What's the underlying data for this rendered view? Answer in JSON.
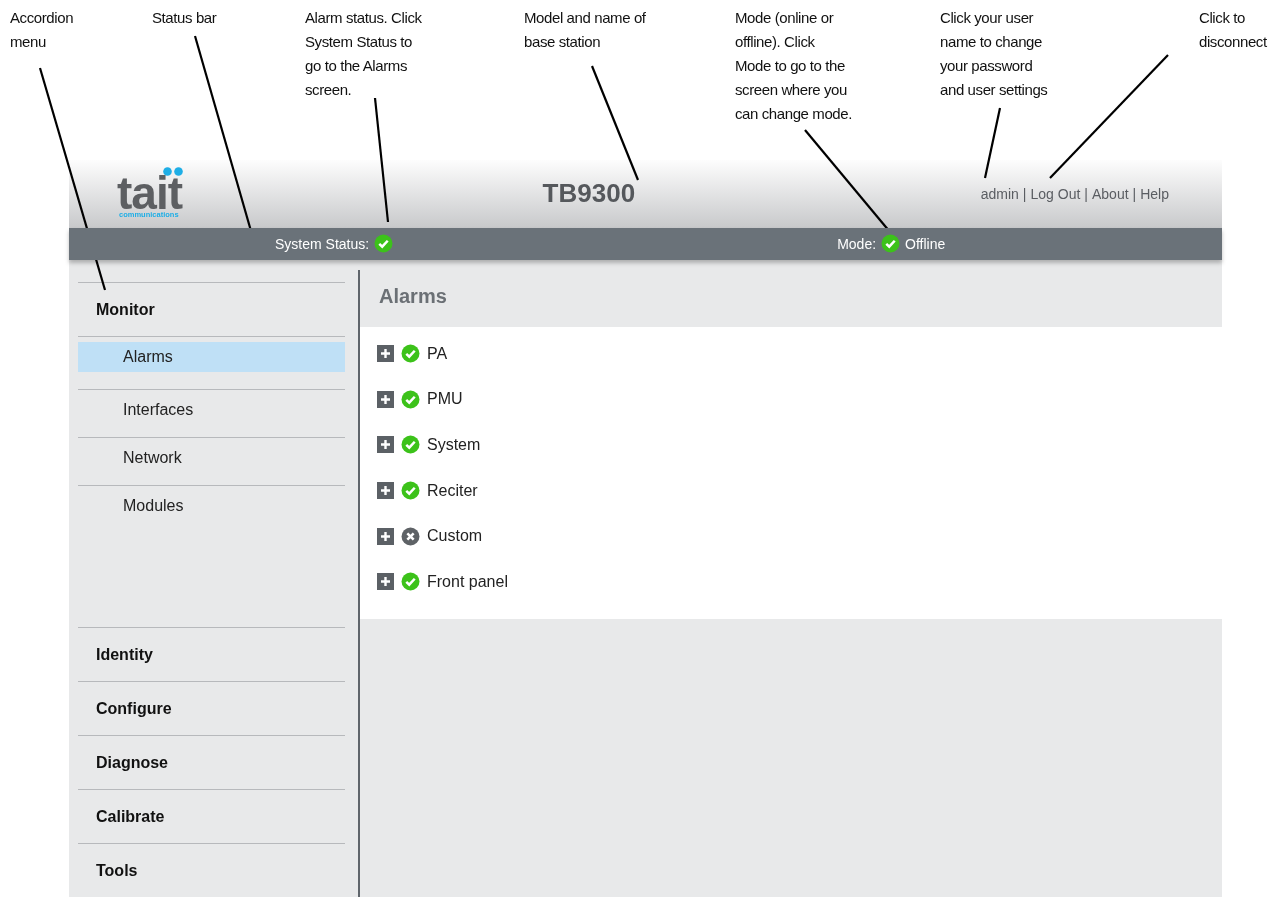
{
  "callouts": [
    {
      "lines": [
        "Accordion",
        "menu"
      ]
    },
    {
      "lines": [
        "Status bar"
      ]
    },
    {
      "lines": [
        "Alarm status. Click",
        "System Status to",
        "go to the Alarms",
        "screen."
      ]
    },
    {
      "lines": [
        "Model and name of",
        "base station"
      ]
    },
    {
      "lines": [
        "Mode (online or",
        "offline). Click",
        "Mode to go to the",
        "screen where you",
        "can change mode."
      ]
    },
    {
      "lines": [
        "Click your user",
        "name to change",
        "your password",
        "and user settings"
      ]
    },
    {
      "lines": [
        "Click to",
        "disconnect"
      ]
    }
  ],
  "header": {
    "logo": {
      "name": "tait",
      "tagline": "communications"
    },
    "title": "TB9300",
    "links": [
      "admin",
      "Log Out",
      "About",
      "Help"
    ],
    "separator": "|"
  },
  "status_bar": {
    "system_status": {
      "label": "System Status:",
      "ok": true
    },
    "mode": {
      "label": "Mode:",
      "ok": true,
      "value": "Offline"
    }
  },
  "sidebar": {
    "sections": [
      {
        "label": "Monitor",
        "items": [
          {
            "label": "Alarms",
            "selected": true
          },
          {
            "label": "Interfaces",
            "selected": false
          },
          {
            "label": "Network",
            "selected": false
          },
          {
            "label": "Modules",
            "selected": false
          }
        ]
      },
      {
        "label": "Identity"
      },
      {
        "label": "Configure"
      },
      {
        "label": "Diagnose"
      },
      {
        "label": "Calibrate"
      },
      {
        "label": "Tools"
      }
    ]
  },
  "content": {
    "title": "Alarms",
    "alarms": [
      {
        "label": "PA",
        "ok": true,
        "expanded": false
      },
      {
        "label": "PMU",
        "ok": true,
        "expanded": false
      },
      {
        "label": "System",
        "ok": true,
        "expanded": false
      },
      {
        "label": "Reciter",
        "ok": true,
        "expanded": false
      },
      {
        "label": "Custom",
        "ok": false,
        "expanded": false
      },
      {
        "label": "Front panel",
        "ok": true,
        "expanded": false
      }
    ]
  }
}
